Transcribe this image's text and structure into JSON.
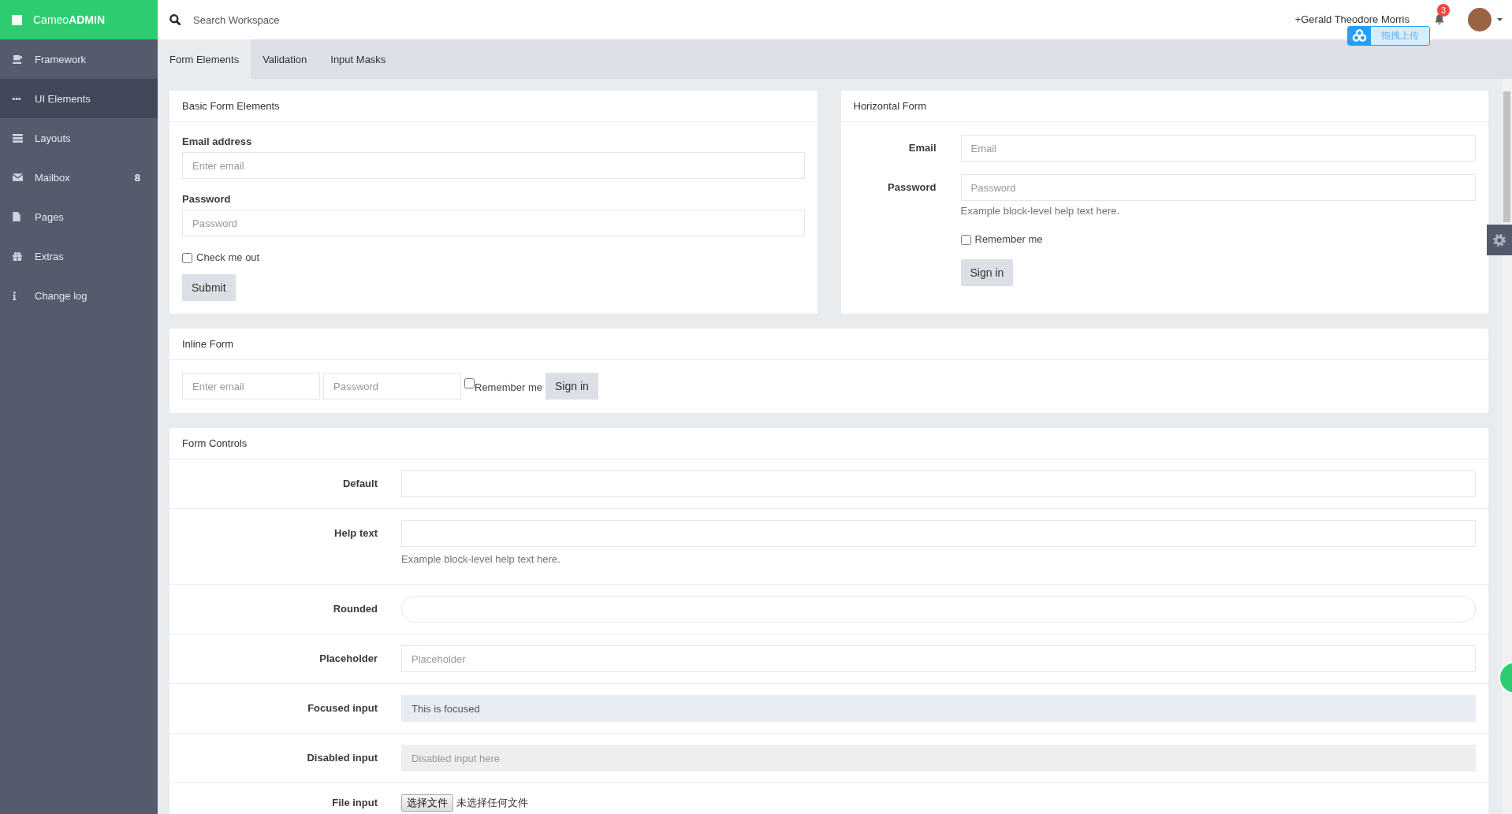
{
  "brand": {
    "logo": "Cameo**ADMIN**"
  },
  "sidebar": {
    "items": [
      {
        "label": "Framework",
        "selected": false
      },
      {
        "label": "UI Elements",
        "selected": true
      },
      {
        "label": "Layouts",
        "selected": false
      },
      {
        "label": "Mailbox",
        "selected": false,
        "badge": "8"
      },
      {
        "label": "Pages",
        "selected": false
      },
      {
        "label": "Extras",
        "selected": false
      },
      {
        "label": "Change log",
        "selected": false
      }
    ]
  },
  "header": {
    "search": {
      "placeholder": "Search Workspace"
    },
    "user_name": "+Gerald Theodore Morris",
    "notification_count": "3",
    "upload_widget": {
      "label": "拖拽上传"
    }
  },
  "tabs": [
    {
      "label": "Form Elements",
      "selected": true
    },
    {
      "label": "Validation",
      "selected": false
    },
    {
      "label": "Input Masks",
      "selected": false
    }
  ],
  "basic_form": {
    "title": "Basic Form Elements",
    "fields": [
      {
        "label": "Email address",
        "placeholder": "Enter email"
      },
      {
        "label": "Password",
        "placeholder": "Password"
      }
    ],
    "checkbox": {
      "label": "Check me out",
      "checked": false
    },
    "button": "Submit"
  },
  "horizontal_form": {
    "title": "Horizontal Form",
    "fields": [
      {
        "label": "Email",
        "placeholder": "Email"
      },
      {
        "label": "Password",
        "placeholder": "Password",
        "help": "Example block-level help text here."
      }
    ],
    "checkbox": {
      "label": "Remember me",
      "checked": false
    },
    "button": "Sign in"
  },
  "inline_form": {
    "title": "Inline Form",
    "fields": [
      {
        "placeholder": "Enter email"
      },
      {
        "placeholder": "Password"
      }
    ],
    "checkbox": {
      "label": "Remember me",
      "checked": false
    },
    "button": "Sign in"
  },
  "form_controls": {
    "title": "Form Controls",
    "rows": [
      {
        "kind": "input",
        "label": "Default",
        "focused": false,
        "disabled": false
      },
      {
        "kind": "input",
        "label": "Help text",
        "help": "Example block-level help text here.",
        "focused": false,
        "disabled": false
      },
      {
        "kind": "rounded",
        "label": "Rounded",
        "focused": false,
        "disabled": false
      },
      {
        "kind": "input",
        "label": "Placeholder",
        "placeholder": "Placeholder",
        "focused": false,
        "disabled": false
      },
      {
        "kind": "input",
        "label": "Focused input",
        "value": "This is focused",
        "focused": true,
        "disabled": false
      },
      {
        "kind": "input",
        "label": "Disabled input",
        "placeholder": "Disabled input here",
        "focused": false,
        "disabled": true
      },
      {
        "kind": "file",
        "label": "File input",
        "button": "选择文件",
        "status": "未选择任何文件",
        "focused": false,
        "disabled": false
      }
    ]
  }
}
